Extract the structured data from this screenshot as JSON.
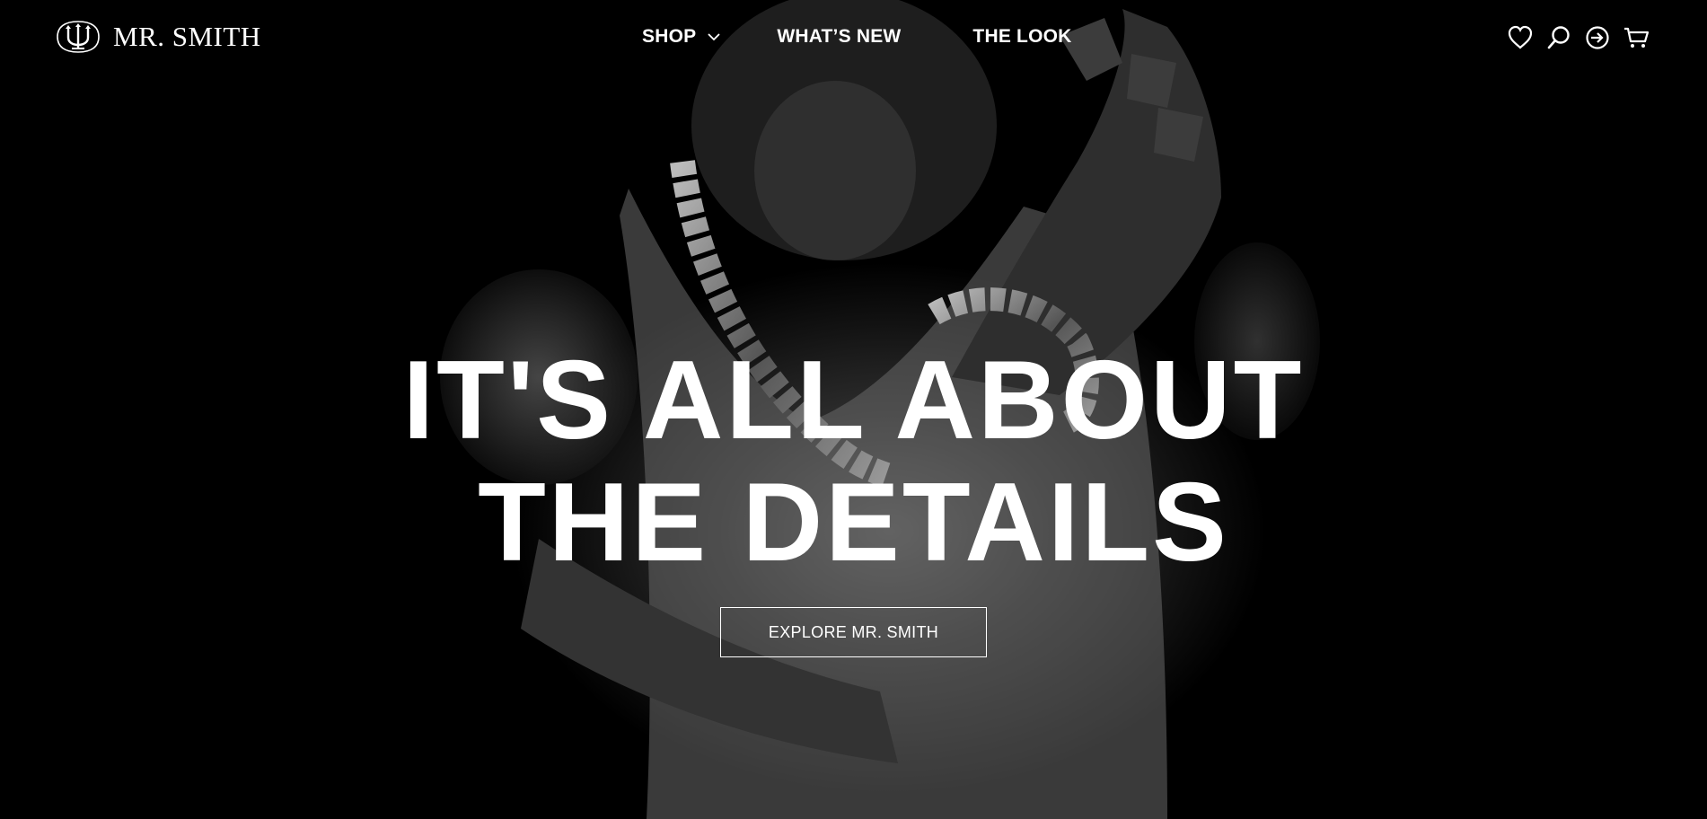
{
  "brand": {
    "name": "MR. SMITH",
    "logo_icon": "trident-crest-icon"
  },
  "nav": {
    "items": [
      {
        "label": "SHOP",
        "has_dropdown": true
      },
      {
        "label": "WHAT’S NEW"
      },
      {
        "label": "THE LOOK"
      }
    ]
  },
  "header_icons": [
    "heart-icon",
    "search-icon",
    "sign-in-icon",
    "cart-icon"
  ],
  "hero": {
    "headline_line1": "IT'S ALL ABOUT",
    "headline_line2": "THE DETAILS",
    "cta_label": "EXPLORE MR. SMITH"
  },
  "colors": {
    "background": "#000000",
    "text": "#ffffff"
  }
}
